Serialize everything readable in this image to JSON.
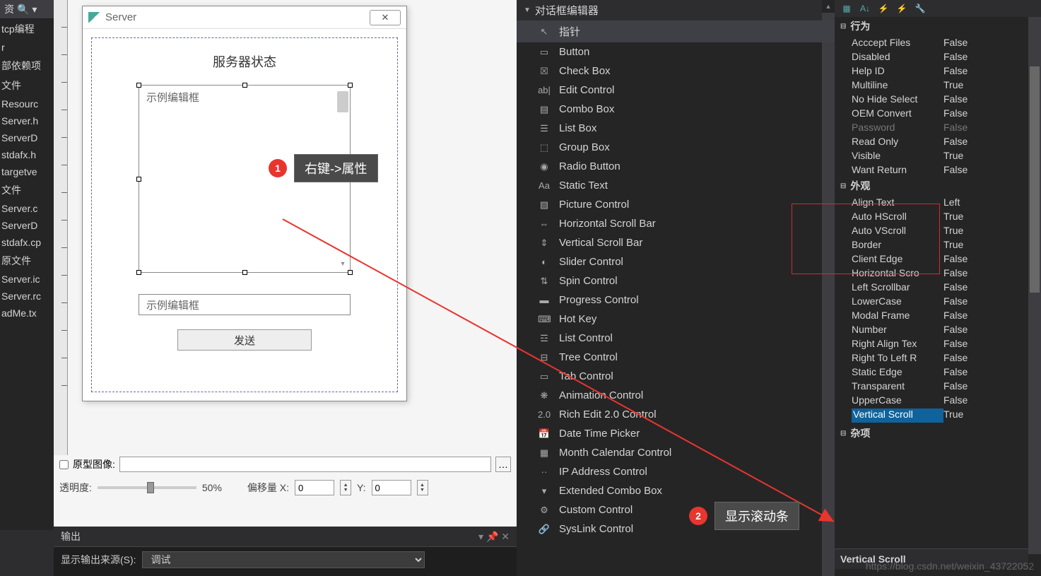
{
  "file_tree": {
    "header_label": "资",
    "items": [
      "tcp编程",
      "r",
      "部依赖项",
      "文件",
      "Resourc",
      "Server.h",
      "ServerD",
      "stdafx.h",
      "targetve",
      "文件",
      "Server.c",
      "ServerD",
      "stdafx.cp",
      "原文件",
      "Server.ic",
      "Server.rc",
      "adMe.tx"
    ]
  },
  "dialog": {
    "title": "Server",
    "status_label": "服务器状态",
    "edit_placeholder_large": "示例编辑框",
    "edit_placeholder_small": "示例编辑框",
    "send_button": "发送"
  },
  "bottom": {
    "proto_label": "原型图像:",
    "opacity_label": "透明度:",
    "opacity_value": "50%",
    "offset_x_label": "偏移量 X:",
    "offset_x_value": "0",
    "offset_y_label": "Y:",
    "offset_y_value": "0"
  },
  "output": {
    "title": "输出",
    "src_label": "显示输出来源(S):",
    "src_value": "调试"
  },
  "toolbox": {
    "header": "对话框编辑器",
    "items": [
      {
        "icon": "↖",
        "label": "指针",
        "selected": true
      },
      {
        "icon": "▭",
        "label": "Button"
      },
      {
        "icon": "☒",
        "label": "Check Box"
      },
      {
        "icon": "ab|",
        "label": "Edit Control"
      },
      {
        "icon": "▤",
        "label": "Combo Box"
      },
      {
        "icon": "☰",
        "label": "List Box"
      },
      {
        "icon": "⬚",
        "label": "Group Box"
      },
      {
        "icon": "◉",
        "label": "Radio Button"
      },
      {
        "icon": "Aa",
        "label": "Static Text"
      },
      {
        "icon": "▨",
        "label": "Picture Control"
      },
      {
        "icon": "⇔",
        "label": "Horizontal Scroll Bar"
      },
      {
        "icon": "⇕",
        "label": "Vertical Scroll Bar"
      },
      {
        "icon": "◐",
        "label": "Slider Control"
      },
      {
        "icon": "⇅",
        "label": "Spin Control"
      },
      {
        "icon": "▬",
        "label": "Progress Control"
      },
      {
        "icon": "⌨",
        "label": "Hot Key"
      },
      {
        "icon": "☲",
        "label": "List Control"
      },
      {
        "icon": "⊟",
        "label": "Tree Control"
      },
      {
        "icon": "▭",
        "label": "Tab Control"
      },
      {
        "icon": "❋",
        "label": "Animation Control"
      },
      {
        "icon": "2.0",
        "label": "Rich Edit 2.0 Control"
      },
      {
        "icon": "📅",
        "label": "Date Time Picker"
      },
      {
        "icon": "▦",
        "label": "Month Calendar Control"
      },
      {
        "icon": "··",
        "label": "IP Address Control"
      },
      {
        "icon": "▾",
        "label": "Extended Combo Box"
      },
      {
        "icon": "⚙",
        "label": "Custom Control"
      },
      {
        "icon": "🔗",
        "label": "SysLink Control"
      }
    ]
  },
  "props": {
    "groups": [
      {
        "name": "行为",
        "rows": [
          {
            "n": "Acccept Files",
            "v": "False"
          },
          {
            "n": "Disabled",
            "v": "False"
          },
          {
            "n": "Help ID",
            "v": "False"
          },
          {
            "n": "Multiline",
            "v": "True"
          },
          {
            "n": "No Hide Select",
            "v": "False"
          },
          {
            "n": "OEM Convert",
            "v": "False"
          },
          {
            "n": "Password",
            "v": "False",
            "dimmed": true
          },
          {
            "n": "Read Only",
            "v": "False"
          },
          {
            "n": "Visible",
            "v": "True"
          },
          {
            "n": "Want Return",
            "v": "False"
          }
        ]
      },
      {
        "name": "外观",
        "rows": [
          {
            "n": "Align Text",
            "v": "Left"
          },
          {
            "n": "Auto HScroll",
            "v": "True"
          },
          {
            "n": "Auto VScroll",
            "v": "True"
          },
          {
            "n": "Border",
            "v": "True"
          },
          {
            "n": "Client Edge",
            "v": "False"
          },
          {
            "n": "Horizontal Scro",
            "v": "False"
          },
          {
            "n": "Left Scrollbar",
            "v": "False"
          },
          {
            "n": "LowerCase",
            "v": "False"
          },
          {
            "n": "Modal Frame",
            "v": "False"
          },
          {
            "n": "Number",
            "v": "False"
          },
          {
            "n": "Right Align Tex",
            "v": "False"
          },
          {
            "n": "Right To Left R",
            "v": "False"
          },
          {
            "n": "Static Edge",
            "v": "False"
          },
          {
            "n": "Transparent",
            "v": "False"
          },
          {
            "n": "UpperCase",
            "v": "False"
          },
          {
            "n": "Vertical Scroll",
            "v": "True",
            "highlight": true
          }
        ]
      },
      {
        "name": "杂项",
        "rows": []
      }
    ],
    "footer_label": "Vertical Scroll"
  },
  "annotations": {
    "badge1": "1",
    "label1": "右键->属性",
    "badge2": "2",
    "label2": "显示滚动条"
  },
  "watermark": "https://blog.csdn.net/weixin_43722052"
}
